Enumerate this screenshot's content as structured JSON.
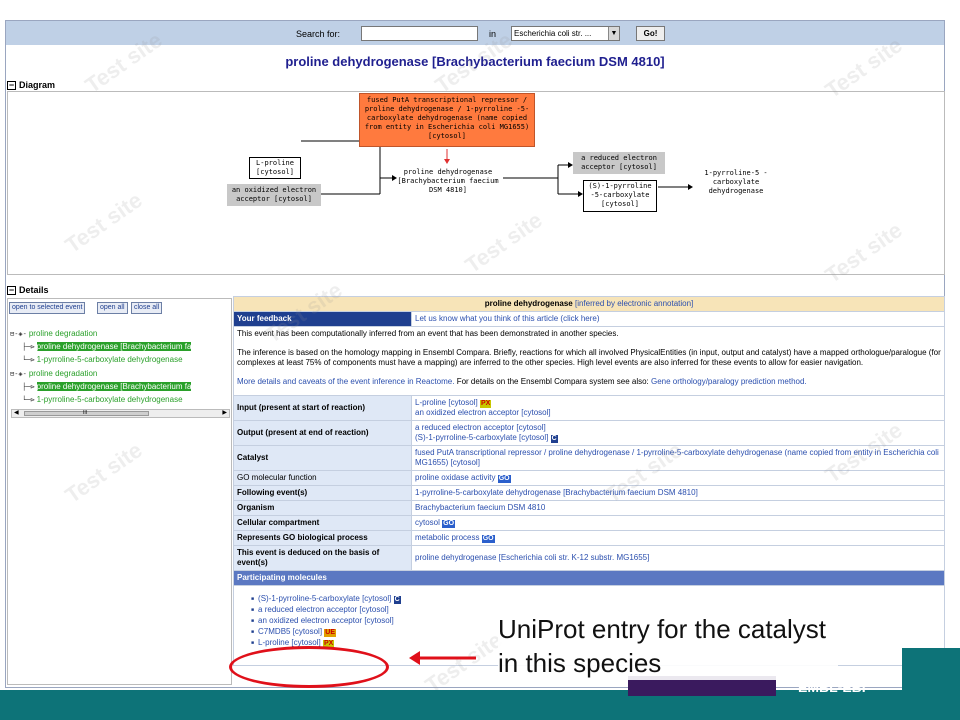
{
  "search": {
    "label": "Search for:",
    "value": "",
    "in_label": "in",
    "species": "Escherichia coli str. ...",
    "go": "Go!"
  },
  "title": "proline dehydrogenase [Brachybacterium faecium DSM 4810]",
  "sections": {
    "diagram": "Diagram",
    "details": "Details"
  },
  "diagram": {
    "catalyst": "fused PutA transcriptional repressor / proline dehydrogenase / 1-pyrroline -5-carboxylate dehydrogenase (name copied from entity in Escherichia coli MG1655) [cytosol]",
    "input1": "L-proline [cytosol]",
    "input2": "an oxidized electron acceptor [cytosol]",
    "reaction": "proline dehydrogenase [Brachybacterium faecium DSM 4810]",
    "output1": "a reduced electron acceptor [cytosol]",
    "output2": "(S)-1-pyrroline -5-carboxylate [cytosol]",
    "next": "1-pyrroline-5 -carboxylate dehydrogenase"
  },
  "tree": {
    "buttons": [
      "open to selected event",
      "open all",
      "close all"
    ],
    "items": [
      {
        "label": "proline degradation",
        "type": "pathway"
      },
      {
        "label": "proline dehydrogenase [Brachybacterium fa",
        "type": "reaction",
        "selected": true
      },
      {
        "label": "1-pyrroline-5-carboxylate dehydrogenase",
        "type": "reaction"
      },
      {
        "label": "proline degradation",
        "type": "pathway"
      },
      {
        "label": "proline dehydrogenase [Brachybacterium fa",
        "type": "reaction",
        "selected": true
      },
      {
        "label": "1-pyrroline-5-carboxylate dehydrogenase",
        "type": "reaction"
      }
    ],
    "scroll_glyph": "III"
  },
  "details": {
    "header_name": "proline dehydrogenase",
    "header_inferred": "[inferred by electronic annotation]",
    "feedback_key": "Your feedback",
    "feedback_val": "Let us know what you think of this article (click here)",
    "summary1": "This event has been computationally inferred from an event that has been demonstrated in another species.",
    "summary2": "The inference is based on the homology mapping in Ensembl Compara. Briefly, reactions for which all involved PhysicalEntities (in input, output and catalyst) have a mapped orthologue/paralogue (for complexes at least 75% of components must have a mapping) are inferred to the other species. High level events are also inferred for these events to allow for easier navigation.",
    "summary3_link": "More details and caveats of the event inference in Reactome.",
    "summary3_text": " For details on the Ensembl Compara system see also: ",
    "summary3_link2": "Gene orthology/paralogy prediction method.",
    "input_key": "Input (present at start of reaction)",
    "input_1": "L-proline [cytosol]",
    "input_2": "an oxidized electron acceptor [cytosol]",
    "output_key": "Output (present at end of reaction)",
    "output_1": "a reduced electron acceptor [cytosol]",
    "output_2": "(S)-1-pyrroline-5-carboxylate [cytosol]",
    "catalyst_key": "Catalyst",
    "catalyst_val": "fused PutA transcriptional repressor / proline dehydrogenase / 1-pyrroline-5-carboxylate dehydrogenase (name copied from entity in Escherichia coli MG1655) [cytosol]",
    "go_mf_key": "GO molecular function",
    "go_mf_val": "proline oxidase activity",
    "following_key": "Following event(s)",
    "following_val": "1-pyrroline-5-carboxylate dehydrogenase [Brachybacterium faecium DSM 4810]",
    "organism_key": "Organism",
    "organism_val": "Brachybacterium faecium DSM 4810",
    "compartment_key": "Cellular compartment",
    "compartment_val": "cytosol",
    "go_bp_key": "Represents GO biological process",
    "go_bp_val": "metabolic process",
    "deduced_key": "This event is deduced on the basis of event(s)",
    "deduced_val": "proline dehydrogenase [Escherichia coli str. K-12 substr. MG1655]",
    "participating_key": "Participating molecules",
    "molecules": [
      {
        "label": "(S)-1-pyrroline-5-carboxylate [cytosol]",
        "badge": "C"
      },
      {
        "label": "a reduced electron acceptor [cytosol]",
        "badge": ""
      },
      {
        "label": "an oxidized electron acceptor [cytosol]",
        "badge": ""
      },
      {
        "label": "C7MDB5 [cytosol]",
        "badge": "UE"
      },
      {
        "label": "L-proline [cytosol]",
        "badge": "PX"
      }
    ],
    "badges": {
      "px": "PX",
      "c": "C",
      "go": "GO",
      "ue": "UE"
    }
  },
  "annotation": "UniProt entry for the catalyst in this species",
  "watermark": "Test site",
  "colors": {
    "accent": "#1f3f8f",
    "annotation_red": "#e0101a",
    "footer_teal": "#0d7378"
  }
}
